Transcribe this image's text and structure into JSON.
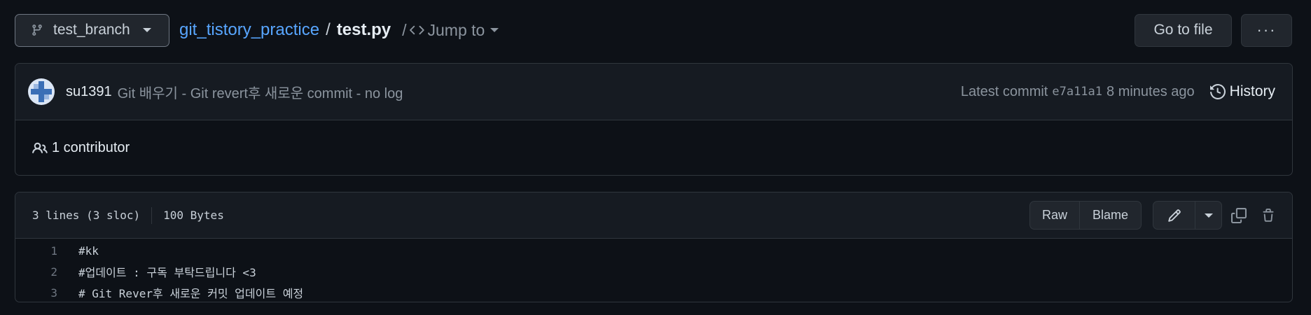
{
  "topbar": {
    "branch": "test_branch",
    "repo": "git_tistory_practice",
    "separator": "/",
    "file": "test.py",
    "jump_sep": "/",
    "jump_label": "Jump to",
    "goto_label": "Go to file",
    "more_label": "···"
  },
  "commit": {
    "author": "su1391",
    "message": "Git 배우기 - Git revert후 새로운 commit - no log",
    "latest_label": "Latest commit",
    "sha": "e7a11a1",
    "time": "8 minutes ago",
    "history_label": "History"
  },
  "contributors": {
    "label": "1 contributor"
  },
  "file": {
    "lines_info": "3 lines (3 sloc)",
    "size": "100 Bytes",
    "raw_label": "Raw",
    "blame_label": "Blame",
    "lines": [
      {
        "num": "1",
        "text": "#kk"
      },
      {
        "num": "2",
        "text": "#업데이트 : 구독 부탁드립니다 <3"
      },
      {
        "num": "3",
        "text": "# Git Rever후 새로운 커밋 업데이트 예정"
      }
    ]
  },
  "icons": {
    "branch": "git-branch-icon",
    "code": "code-icon",
    "history": "history-icon",
    "people": "people-icon",
    "pencil": "pencil-icon",
    "copy": "copy-icon",
    "trash": "trash-icon"
  },
  "colors": {
    "bg": "#0d1117",
    "link": "#58a6ff",
    "border": "#30363d",
    "muted": "#8b949e"
  }
}
